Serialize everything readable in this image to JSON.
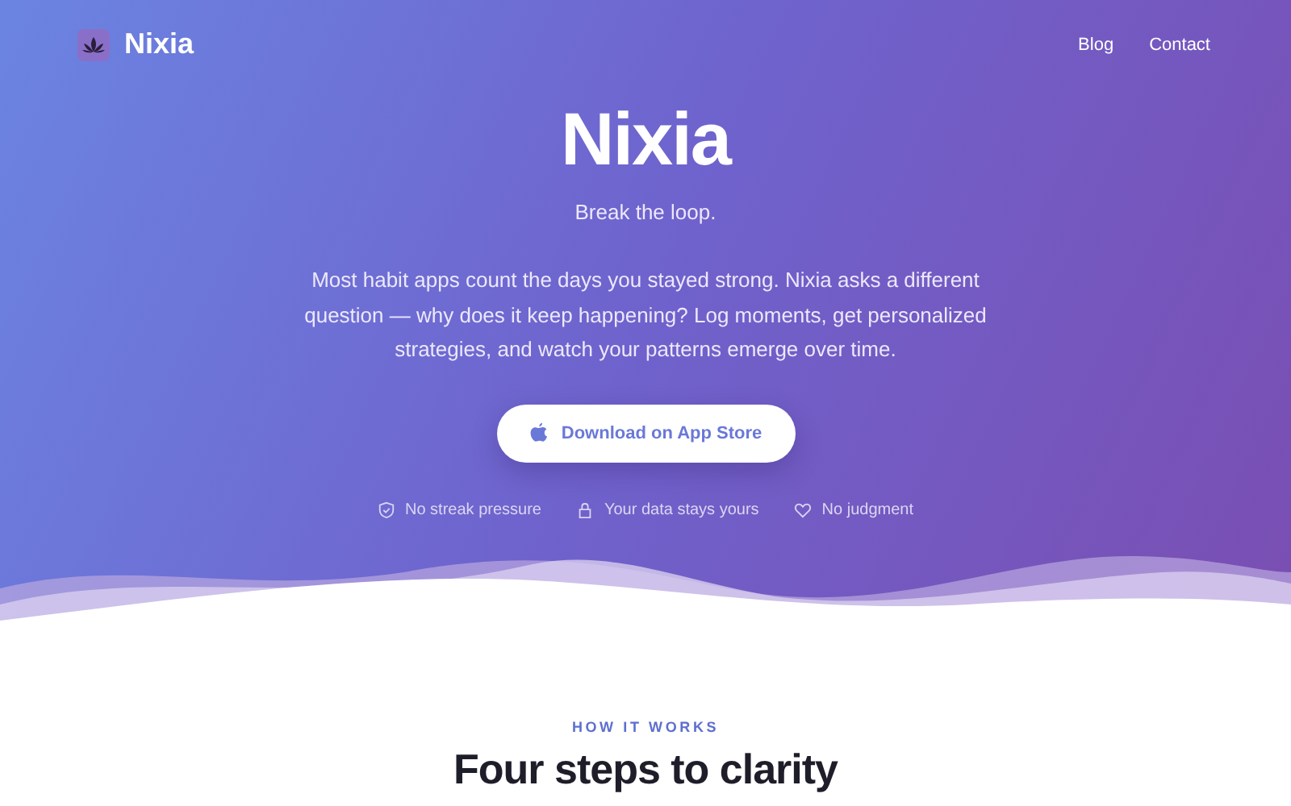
{
  "nav": {
    "brand": "Nixia",
    "links": [
      {
        "label": "Blog"
      },
      {
        "label": "Contact"
      }
    ]
  },
  "hero": {
    "title": "Nixia",
    "tagline": "Break the loop.",
    "description": "Most habit apps count the days you stayed strong. Nixia asks a different question — why does it keep happening? Log moments, get personalized strategies, and watch your patterns emerge over time.",
    "cta": "Download on App Store",
    "features": [
      {
        "kind": "shield",
        "label": "No streak pressure"
      },
      {
        "kind": "lock",
        "label": "Your data stays yours"
      },
      {
        "kind": "heart",
        "label": "No judgment"
      }
    ]
  },
  "section": {
    "eyebrow": "HOW IT WORKS",
    "heading": "Four steps to clarity"
  }
}
